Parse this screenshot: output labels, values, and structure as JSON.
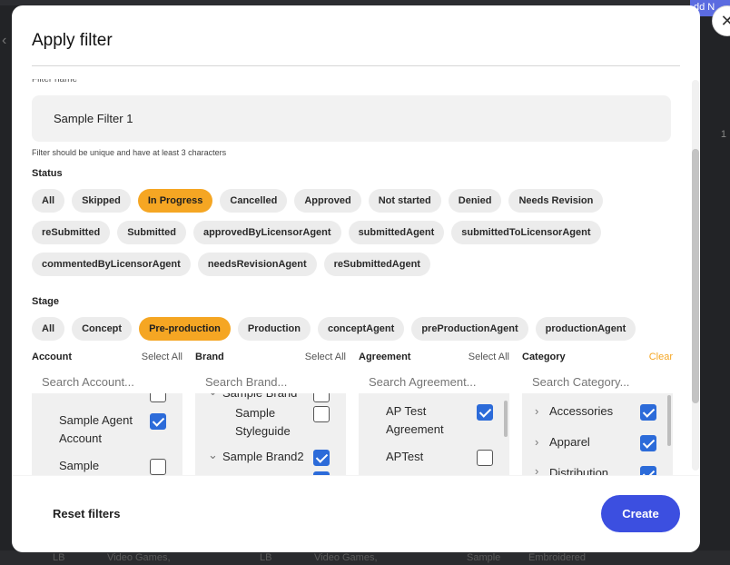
{
  "background": {
    "badge": "dd N",
    "right_number": "1",
    "bottom_texts": [
      "LB",
      "Video Games,",
      "LB",
      "Video Games,",
      "Sample",
      "Embroidered"
    ]
  },
  "modal": {
    "title": "Apply filter",
    "close_icon": "close-icon",
    "filter_name_label": "Filter name",
    "filter_name_value": "Sample Filter 1",
    "filter_name_hint": "Filter should be unique and have at least 3 characters",
    "status": {
      "label": "Status",
      "rows": [
        [
          "All",
          "Skipped",
          "In Progress",
          "Cancelled",
          "Approved",
          "Not started",
          "Denied",
          "Needs Revision"
        ],
        [
          "reSubmitted",
          "Submitted",
          "approvedByLicensorAgent",
          "submittedAgent",
          "submittedToLicensorAgent"
        ],
        [
          "commentedByLicensorAgent",
          "needsRevisionAgent",
          "reSubmittedAgent"
        ]
      ],
      "selected": "In Progress"
    },
    "stage": {
      "label": "Stage",
      "options": [
        "All",
        "Concept",
        "Pre-production",
        "Production",
        "conceptAgent",
        "preProductionAgent",
        "productionAgent"
      ],
      "selected": "Pre-production"
    },
    "account": {
      "title": "Account",
      "action": "Select All",
      "placeholder": "Search Account...",
      "items": [
        {
          "label": "Sample Agent Account",
          "checked": true
        },
        {
          "label": "Sample",
          "checked": false
        }
      ]
    },
    "brand": {
      "title": "Brand",
      "action": "Select All",
      "placeholder": "Search Brand...",
      "items": [
        {
          "label": "Sample Brand",
          "checked": false
        },
        {
          "label": "Sample Styleguide",
          "checked": false
        },
        {
          "label": "Sample Brand2",
          "checked": true
        }
      ]
    },
    "agreement": {
      "title": "Agreement",
      "action": "Select All",
      "placeholder": "Search Agreement...",
      "items": [
        {
          "label": "AP Test Agreement",
          "checked": true
        },
        {
          "label": "APTest",
          "checked": false
        }
      ]
    },
    "category": {
      "title": "Category",
      "action": "Clear",
      "placeholder": "Search Category...",
      "items": [
        {
          "label": "Accessories",
          "checked": true
        },
        {
          "label": "Apparel",
          "checked": true
        },
        {
          "label": "Distribution",
          "checked": true
        }
      ]
    },
    "footer": {
      "reset_label": "Reset filters",
      "create_label": "Create"
    },
    "colors": {
      "accent": "#f5a623",
      "primary": "#3c4fe0",
      "checkbox": "#2c6bd9"
    }
  }
}
